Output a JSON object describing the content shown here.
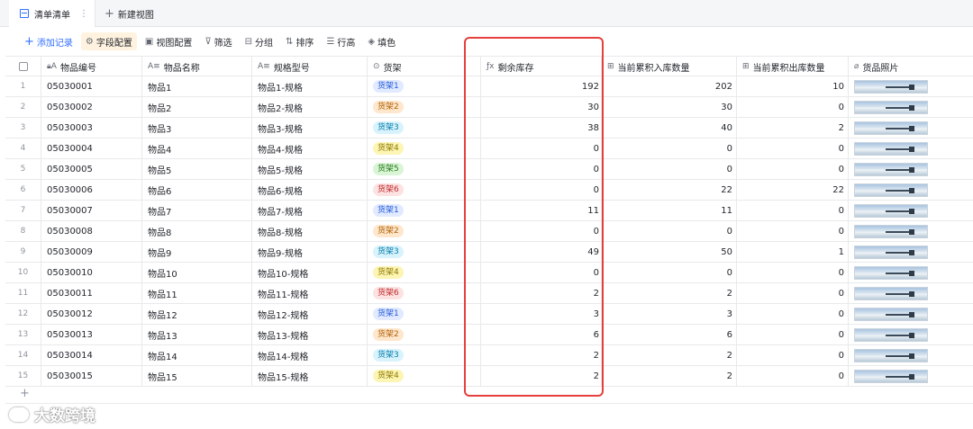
{
  "tabs": {
    "active_label": "清单清单",
    "more": "⋮",
    "new_view_label": "新建视图"
  },
  "toolbar": {
    "add_record": "添加记录",
    "field_config": "字段配置",
    "view_config": "视图配置",
    "filter": "筛选",
    "group": "分组",
    "sort": "排序",
    "row_height": "行高",
    "fill_color": "填色"
  },
  "columns": {
    "code": "物品编号",
    "name": "物品名称",
    "spec": "规格型号",
    "shelf": "货架",
    "stock": "剩余库存",
    "in_qty": "当前累积入库数量",
    "out_qty": "当前累积出库数量",
    "photo": "货品照片"
  },
  "shelf_colors": {
    "货架1": {
      "bg": "#e1eaff",
      "fg": "#245bdb"
    },
    "货架2": {
      "bg": "#fee7cd",
      "fg": "#b26206"
    },
    "货架3": {
      "bg": "#d9f3fd",
      "fg": "#037eaa"
    },
    "货架4": {
      "bg": "#fdf5b4",
      "fg": "#8f7a00"
    },
    "货架5": {
      "bg": "#d9f5d6",
      "fg": "#237b19"
    },
    "货架6": {
      "bg": "#fde2e2",
      "fg": "#c02a2a"
    }
  },
  "rows": [
    {
      "idx": "1",
      "code": "05030001",
      "name": "物品1",
      "spec": "物品1-规格",
      "shelf": "货架1",
      "stock": "192",
      "in_qty": "202",
      "out_qty": "10"
    },
    {
      "idx": "2",
      "code": "05030002",
      "name": "物品2",
      "spec": "物品2-规格",
      "shelf": "货架2",
      "stock": "30",
      "in_qty": "30",
      "out_qty": "0"
    },
    {
      "idx": "3",
      "code": "05030003",
      "name": "物品3",
      "spec": "物品3-规格",
      "shelf": "货架3",
      "stock": "38",
      "in_qty": "40",
      "out_qty": "2"
    },
    {
      "idx": "4",
      "code": "05030004",
      "name": "物品4",
      "spec": "物品4-规格",
      "shelf": "货架4",
      "stock": "0",
      "in_qty": "0",
      "out_qty": "0"
    },
    {
      "idx": "5",
      "code": "05030005",
      "name": "物品5",
      "spec": "物品5-规格",
      "shelf": "货架5",
      "stock": "0",
      "in_qty": "0",
      "out_qty": "0"
    },
    {
      "idx": "6",
      "code": "05030006",
      "name": "物品6",
      "spec": "物品6-规格",
      "shelf": "货架6",
      "stock": "0",
      "in_qty": "22",
      "out_qty": "22"
    },
    {
      "idx": "7",
      "code": "05030007",
      "name": "物品7",
      "spec": "物品7-规格",
      "shelf": "货架1",
      "stock": "11",
      "in_qty": "11",
      "out_qty": "0"
    },
    {
      "idx": "8",
      "code": "05030008",
      "name": "物品8",
      "spec": "物品8-规格",
      "shelf": "货架2",
      "stock": "0",
      "in_qty": "0",
      "out_qty": "0"
    },
    {
      "idx": "9",
      "code": "05030009",
      "name": "物品9",
      "spec": "物品9-规格",
      "shelf": "货架3",
      "stock": "49",
      "in_qty": "50",
      "out_qty": "1"
    },
    {
      "idx": "10",
      "code": "05030010",
      "name": "物品10",
      "spec": "物品10-规格",
      "shelf": "货架4",
      "stock": "0",
      "in_qty": "0",
      "out_qty": "0"
    },
    {
      "idx": "11",
      "code": "05030011",
      "name": "物品11",
      "spec": "物品11-规格",
      "shelf": "货架6",
      "stock": "2",
      "in_qty": "2",
      "out_qty": "0"
    },
    {
      "idx": "12",
      "code": "05030012",
      "name": "物品12",
      "spec": "物品12-规格",
      "shelf": "货架1",
      "stock": "3",
      "in_qty": "3",
      "out_qty": "0"
    },
    {
      "idx": "13",
      "code": "05030013",
      "name": "物品13",
      "spec": "物品13-规格",
      "shelf": "货架2",
      "stock": "6",
      "in_qty": "6",
      "out_qty": "0"
    },
    {
      "idx": "14",
      "code": "05030014",
      "name": "物品14",
      "spec": "物品14-规格",
      "shelf": "货架3",
      "stock": "2",
      "in_qty": "2",
      "out_qty": "0"
    },
    {
      "idx": "15",
      "code": "05030015",
      "name": "物品15",
      "spec": "物品15-规格",
      "shelf": "货架4",
      "stock": "2",
      "in_qty": "2",
      "out_qty": "0"
    }
  ],
  "footer": {
    "add_row": "+",
    "brand": "大数跨境"
  },
  "highlight_color": "#e5403d"
}
